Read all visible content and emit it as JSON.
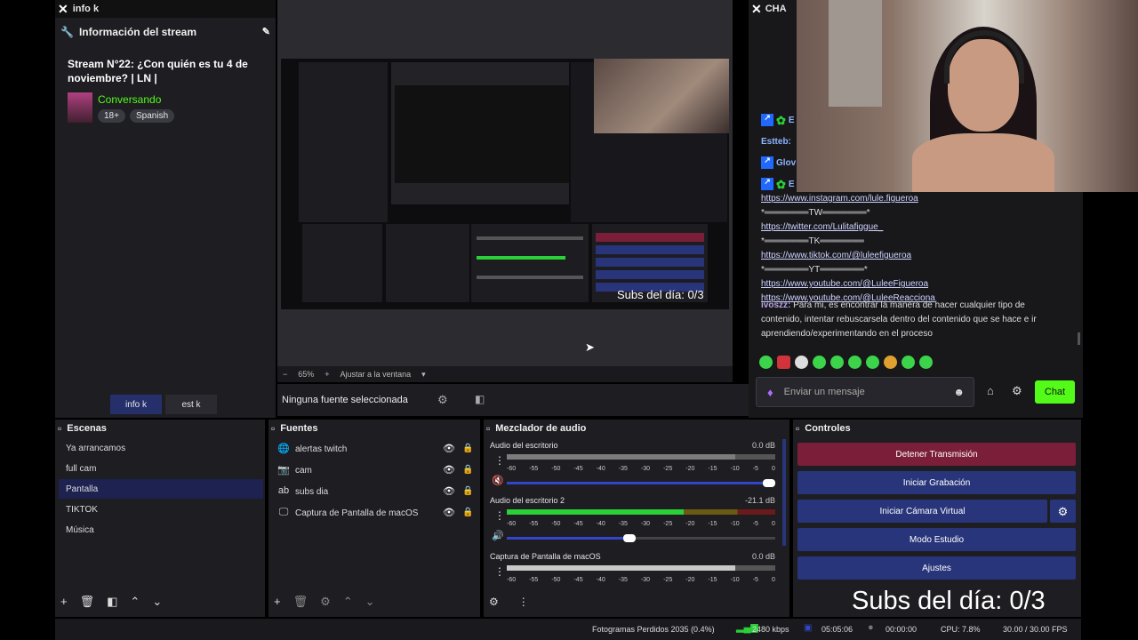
{
  "info_dock": {
    "tab_title": "info k",
    "header": "Información del stream",
    "stream_title": "Stream N°22: ¿Con quién es tu 4 de noviembre? | LN |",
    "category": "Conversando",
    "tags": [
      "18+",
      "Spanish"
    ],
    "bottom_tabs": [
      "info k",
      "est k"
    ]
  },
  "preview": {
    "zoom": "65%",
    "zoom_plus": "+",
    "zoom_minus": "−",
    "fit_label": "Ajustar a la ventana",
    "no_source": "Ninguna fuente seleccionada",
    "inner_subs": "Subs del día: 0/3"
  },
  "chat": {
    "tab_title": "CHA",
    "users": [
      "E",
      "Estteb:",
      "Glov",
      "E"
    ],
    "lines": [
      {
        "type": "link",
        "text": "https://www.instagram.com/lule.figueroa"
      },
      {
        "type": "sep",
        "text": "*═══════TW═══════*"
      },
      {
        "type": "link",
        "text": "https://twitter.com/Lulitafiggue_"
      },
      {
        "type": "sep",
        "text": "*═══════TK═══════"
      },
      {
        "type": "link",
        "text": "https://www.tiktok.com/@luleefigueroa"
      },
      {
        "type": "sep",
        "text": "*═══════YT═══════*"
      },
      {
        "type": "link",
        "text": "https://www.youtube.com/@LuleeFigueroa"
      },
      {
        "type": "link",
        "text": "https://www.youtube.com/@LuleeReacciona"
      }
    ],
    "message_user": "ivoszz:",
    "message_text": "Para mi, es encontrar la manera de hacer cualquier tipo de contenido, intentar rebuscarsela dentro del contenido que se hace e ir aprendiendo/experimentando en el proceso",
    "input_placeholder": "Enviar un mensaje",
    "send_label": "Chat"
  },
  "scenes": {
    "title": "Escenas",
    "items": [
      "Ya arrancamos",
      "full cam",
      "Pantalla",
      "TIKTOK",
      "Música"
    ],
    "selected": "Pantalla"
  },
  "sources": {
    "title": "Fuentes",
    "items": [
      {
        "name": "alertas twitch",
        "icon": "globe-icon"
      },
      {
        "name": "cam",
        "icon": "camera-icon"
      },
      {
        "name": "subs dia",
        "icon": "text-icon"
      },
      {
        "name": "Captura de Pantalla de macOS",
        "icon": "monitor-icon"
      }
    ]
  },
  "mixer": {
    "title": "Mezclador de audio",
    "ticks": [
      "-60",
      "-55",
      "-50",
      "-45",
      "-40",
      "-35",
      "-30",
      "-25",
      "-20",
      "-15",
      "-10",
      "-5",
      "0"
    ],
    "channels": [
      {
        "name": "Audio del escritorio",
        "db": "0.0 dB",
        "level": 0.85,
        "volume": 1.0,
        "muted": true
      },
      {
        "name": "Audio del escritorio 2",
        "db": "-21.1 dB",
        "level": 0.66,
        "volume": 0.48,
        "muted": false
      },
      {
        "name": "Captura de Pantalla de macOS",
        "db": "0.0 dB",
        "level": 0.85,
        "volume": 1.0,
        "muted": true
      }
    ]
  },
  "controls": {
    "title": "Controles",
    "stop_stream": "Detener Transmisión",
    "start_recording": "Iniciar Grabación",
    "virtual_cam": "Iniciar Cámara Virtual",
    "studio_mode": "Modo Estudio",
    "settings": "Ajustes",
    "colors": {
      "stop": "#7a1e3a",
      "normal": "#28357a"
    }
  },
  "overlay": {
    "subs_text": "Subs del día: 0/3"
  },
  "status_bar": {
    "dropped_frames": "Fotogramas Perdidos 2035 (0.4%)",
    "bitrate": "2480 kbps",
    "stream_time": "05:05:06",
    "rec_time": "00:00:00",
    "cpu": "CPU: 7.8%",
    "fps": "30.00 / 30.00 FPS"
  }
}
